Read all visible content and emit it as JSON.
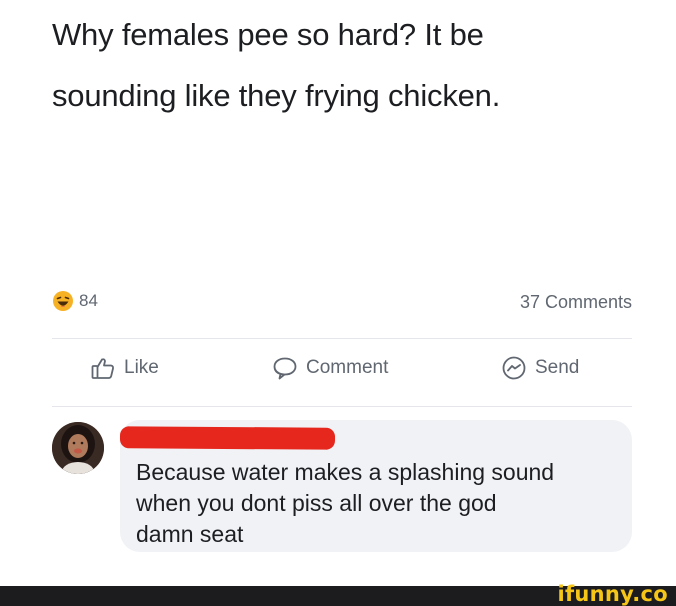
{
  "post": {
    "text_lines": [
      "Why females pee so hard? It be",
      "sounding like they frying chicken."
    ]
  },
  "stats": {
    "reaction_icon": "haha-laughing-emoji-icon",
    "reaction_count": "84",
    "comments_count": "37 Comments"
  },
  "actions": {
    "like_label": "Like",
    "like_icon": "thumbs-up-icon",
    "comment_label": "Comment",
    "comment_icon": "speech-bubble-icon",
    "send_label": "Send",
    "send_icon": "messenger-icon"
  },
  "comment": {
    "avatar": "user-avatar",
    "commenter_name": "",
    "name_redacted": true,
    "redaction_color": "#e5271d",
    "text_lines": [
      "Because water makes a splashing sound",
      "when you dont piss all over the god",
      "damn seat"
    ]
  },
  "watermark": {
    "text": "ifunny.co",
    "color": "#f5c518"
  },
  "colors": {
    "text_primary": "#1c1e21",
    "text_secondary": "#606770",
    "bubble_bg": "#f0f2f5",
    "divider": "#e4e6eb"
  }
}
